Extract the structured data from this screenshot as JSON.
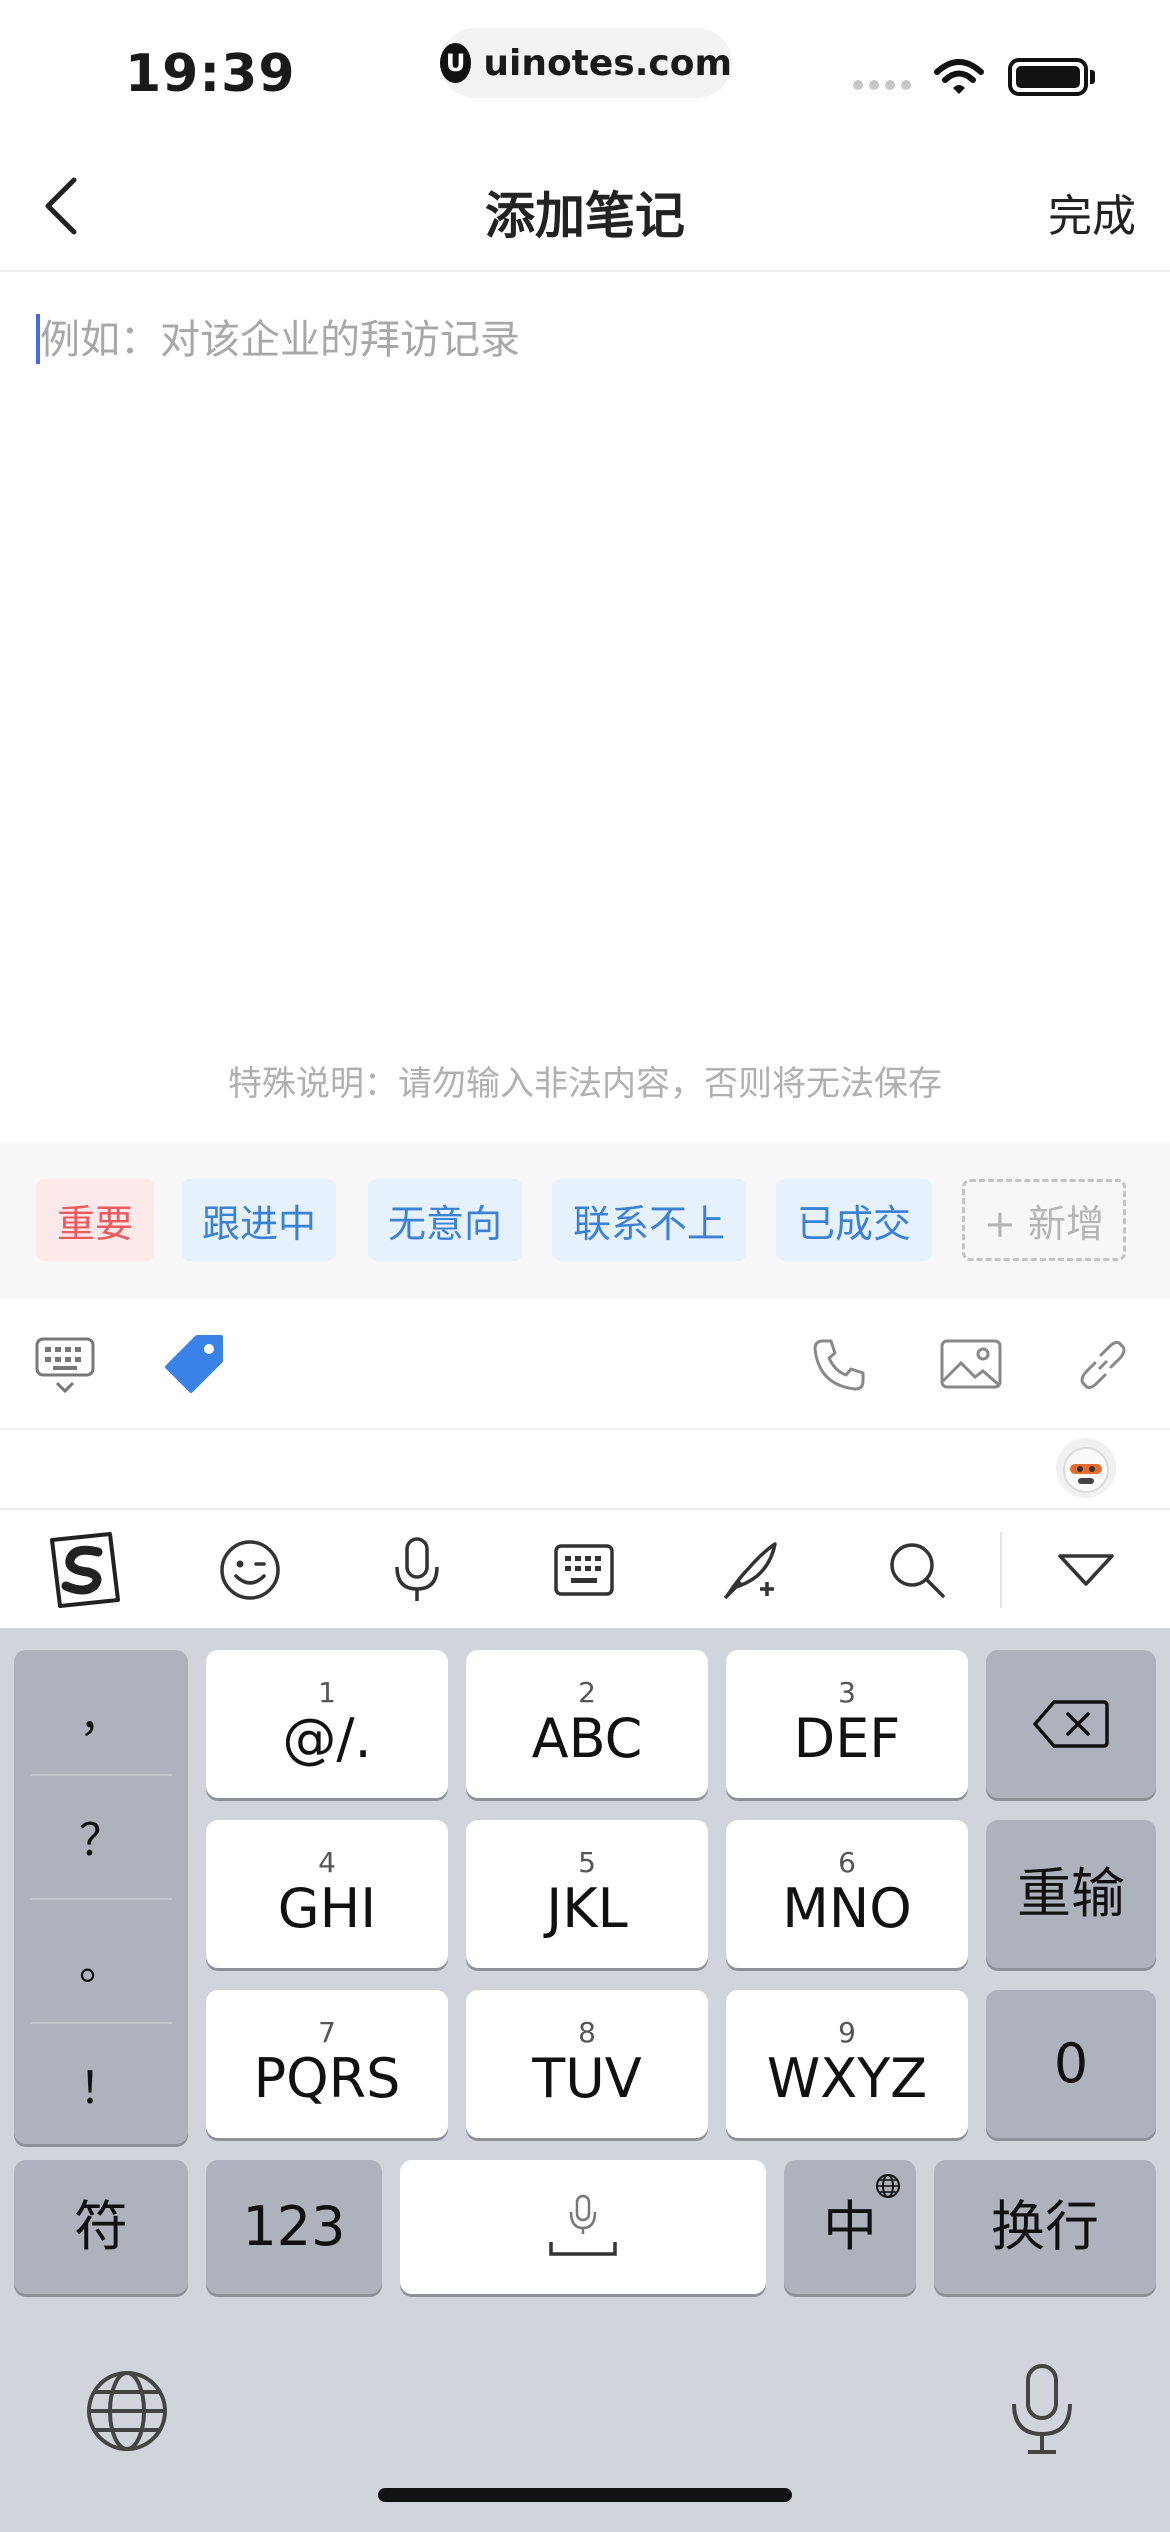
{
  "status_bar": {
    "time": "19:39",
    "url": "uinotes.com",
    "logo_letter": "U"
  },
  "nav": {
    "title": "添加笔记",
    "done": "完成"
  },
  "editor": {
    "placeholder": "例如：对该企业的拜访记录",
    "value": "",
    "disclaimer": "特殊说明：请勿输入非法内容，否则将无法保存"
  },
  "tags": [
    {
      "label": "重要",
      "style": "red"
    },
    {
      "label": "跟进中",
      "style": "blue"
    },
    {
      "label": "无意向",
      "style": "blue"
    },
    {
      "label": "联系不上",
      "style": "blue"
    },
    {
      "label": "已成交",
      "style": "blue"
    }
  ],
  "add_tag_label": "+ 新增",
  "toolbar_icons": [
    "keyboard-hide-icon",
    "tag-icon",
    "phone-icon",
    "image-icon",
    "link-icon"
  ],
  "ime_toolbar_icons": [
    "sogou-logo-icon",
    "emoji-icon",
    "microphone-icon",
    "keyboard-icon",
    "handwriting-icon",
    "search-icon",
    "collapse-icon"
  ],
  "keyboard": {
    "punctuation": [
      "，",
      "？",
      "。",
      "！"
    ],
    "keys": [
      {
        "num": "1",
        "label": "@/."
      },
      {
        "num": "2",
        "label": "ABC"
      },
      {
        "num": "3",
        "label": "DEF"
      },
      {
        "num": "4",
        "label": "GHI"
      },
      {
        "num": "5",
        "label": "JKL"
      },
      {
        "num": "6",
        "label": "MNO"
      },
      {
        "num": "7",
        "label": "PQRS"
      },
      {
        "num": "8",
        "label": "TUV"
      },
      {
        "num": "9",
        "label": "WXYZ"
      }
    ],
    "reenter": "重输",
    "zero": "0",
    "symbols": "符",
    "numbers": "123",
    "lang": "中",
    "newline": "换行"
  },
  "colors": {
    "accent_blue": "#3b82d6",
    "tag_red": "#ec5a5f",
    "tag_icon": "#3b82e6",
    "caret": "#4a66e8"
  }
}
